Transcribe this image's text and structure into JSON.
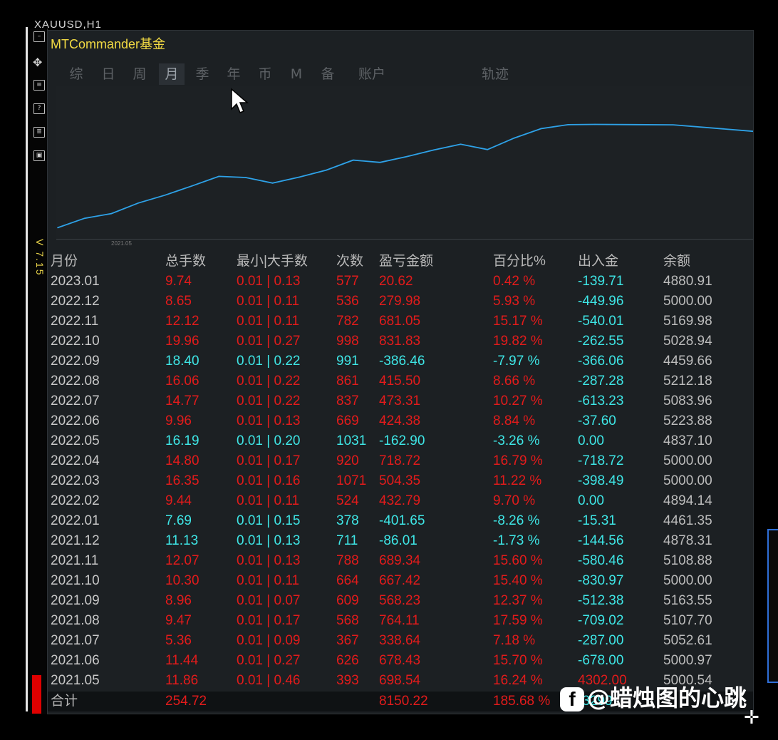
{
  "window": {
    "symbol_title": "XAUUSD,H1",
    "version": "V 7.15"
  },
  "panel": {
    "title": "MTCommander基金",
    "tabs": [
      "综",
      "日",
      "周",
      "月",
      "季",
      "年",
      "币",
      "M",
      "备",
      "账户",
      "轨迹"
    ],
    "active_tab": "月"
  },
  "toolbar_icons": [
    "minimize-icon",
    "move-icon",
    "clear-icon",
    "help-icon",
    "settings-icon",
    "restore-icon"
  ],
  "chart_data": {
    "type": "line",
    "x": [
      "2021.05",
      "2021.06",
      "2021.07",
      "2021.08",
      "2021.09",
      "2021.10",
      "2021.11",
      "2021.12",
      "2022.01",
      "2022.02",
      "2022.03",
      "2022.04",
      "2022.05",
      "2022.06",
      "2022.07",
      "2022.08",
      "2022.09",
      "2022.10",
      "2022.11",
      "2022.12",
      "2023.01"
    ],
    "series": [
      {
        "values": [
          698.54,
          1376.97,
          1715.61,
          2479.72,
          3047.95,
          3715.37,
          4404.71,
          4318.7,
          3917.05,
          4349.84,
          4854.19,
          5572.91,
          5410.01,
          5834.39,
          6307.7,
          6723.2,
          6336.74,
          7168.57,
          7849.62,
          8129.6,
          8150.22
        ],
        "color": "#2ea2e8"
      }
    ],
    "xlabel": "",
    "ylabel": "",
    "tick_labels": [
      "2021.05"
    ],
    "ylim": [
      0,
      10800
    ],
    "grid": false
  },
  "table": {
    "headers": [
      "月份",
      "总手数",
      "最小|大手数",
      "次数",
      "盈亏金额",
      "百分比%",
      "出入金",
      "余额"
    ],
    "rows": [
      {
        "month": "2023.01",
        "lots": "9.74",
        "minmax": "0.01 | 0.13",
        "count": "577",
        "pnl": "20.62",
        "pct": "0.42 %",
        "flow": "-139.71",
        "balance": "4880.91",
        "sign": "pos"
      },
      {
        "month": "2022.12",
        "lots": "8.65",
        "minmax": "0.01 | 0.11",
        "count": "536",
        "pnl": "279.98",
        "pct": "5.93 %",
        "flow": "-449.96",
        "balance": "5000.00",
        "sign": "pos"
      },
      {
        "month": "2022.11",
        "lots": "12.12",
        "minmax": "0.01 | 0.11",
        "count": "782",
        "pnl": "681.05",
        "pct": "15.17 %",
        "flow": "-540.01",
        "balance": "5169.98",
        "sign": "pos"
      },
      {
        "month": "2022.10",
        "lots": "19.96",
        "minmax": "0.01 | 0.27",
        "count": "998",
        "pnl": "831.83",
        "pct": "19.82 %",
        "flow": "-262.55",
        "balance": "5028.94",
        "sign": "pos"
      },
      {
        "month": "2022.09",
        "lots": "18.40",
        "minmax": "0.01 | 0.22",
        "count": "991",
        "pnl": "-386.46",
        "pct": "-7.97 %",
        "flow": "-366.06",
        "balance": "4459.66",
        "sign": "neg"
      },
      {
        "month": "2022.08",
        "lots": "16.06",
        "minmax": "0.01 | 0.22",
        "count": "861",
        "pnl": "415.50",
        "pct": "8.66 %",
        "flow": "-287.28",
        "balance": "5212.18",
        "sign": "pos"
      },
      {
        "month": "2022.07",
        "lots": "14.77",
        "minmax": "0.01 | 0.22",
        "count": "837",
        "pnl": "473.31",
        "pct": "10.27 %",
        "flow": "-613.23",
        "balance": "5083.96",
        "sign": "pos"
      },
      {
        "month": "2022.06",
        "lots": "9.96",
        "minmax": "0.01 | 0.13",
        "count": "669",
        "pnl": "424.38",
        "pct": "8.84 %",
        "flow": "-37.60",
        "balance": "5223.88",
        "sign": "pos"
      },
      {
        "month": "2022.05",
        "lots": "16.19",
        "minmax": "0.01 | 0.20",
        "count": "1031",
        "pnl": "-162.90",
        "pct": "-3.26 %",
        "flow": "0.00",
        "balance": "4837.10",
        "sign": "neg"
      },
      {
        "month": "2022.04",
        "lots": "14.80",
        "minmax": "0.01 | 0.17",
        "count": "920",
        "pnl": "718.72",
        "pct": "16.79 %",
        "flow": "-718.72",
        "balance": "5000.00",
        "sign": "pos"
      },
      {
        "month": "2022.03",
        "lots": "16.35",
        "minmax": "0.01 | 0.16",
        "count": "1071",
        "pnl": "504.35",
        "pct": "11.22 %",
        "flow": "-398.49",
        "balance": "5000.00",
        "sign": "pos"
      },
      {
        "month": "2022.02",
        "lots": "9.44",
        "minmax": "0.01 | 0.11",
        "count": "524",
        "pnl": "432.79",
        "pct": "9.70 %",
        "flow": "0.00",
        "balance": "4894.14",
        "sign": "pos"
      },
      {
        "month": "2022.01",
        "lots": "7.69",
        "minmax": "0.01 | 0.15",
        "count": "378",
        "pnl": "-401.65",
        "pct": "-8.26 %",
        "flow": "-15.31",
        "balance": "4461.35",
        "sign": "neg"
      },
      {
        "month": "2021.12",
        "lots": "11.13",
        "minmax": "0.01 | 0.13",
        "count": "711",
        "pnl": "-86.01",
        "pct": "-1.73 %",
        "flow": "-144.56",
        "balance": "4878.31",
        "sign": "neg"
      },
      {
        "month": "2021.11",
        "lots": "12.07",
        "minmax": "0.01 | 0.13",
        "count": "788",
        "pnl": "689.34",
        "pct": "15.60 %",
        "flow": "-580.46",
        "balance": "5108.88",
        "sign": "pos"
      },
      {
        "month": "2021.10",
        "lots": "10.30",
        "minmax": "0.01 | 0.11",
        "count": "664",
        "pnl": "667.42",
        "pct": "15.40 %",
        "flow": "-830.97",
        "balance": "5000.00",
        "sign": "pos"
      },
      {
        "month": "2021.09",
        "lots": "8.96",
        "minmax": "0.01 | 0.07",
        "count": "609",
        "pnl": "568.23",
        "pct": "12.37 %",
        "flow": "-512.38",
        "balance": "5163.55",
        "sign": "pos"
      },
      {
        "month": "2021.08",
        "lots": "9.47",
        "minmax": "0.01 | 0.17",
        "count": "568",
        "pnl": "764.11",
        "pct": "17.59 %",
        "flow": "-709.02",
        "balance": "5107.70",
        "sign": "pos"
      },
      {
        "month": "2021.07",
        "lots": "5.36",
        "minmax": "0.01 | 0.09",
        "count": "367",
        "pnl": "338.64",
        "pct": "7.18 %",
        "flow": "-287.00",
        "balance": "5052.61",
        "sign": "pos"
      },
      {
        "month": "2021.06",
        "lots": "11.44",
        "minmax": "0.01 | 0.27",
        "count": "626",
        "pnl": "678.43",
        "pct": "15.70 %",
        "flow": "-678.00",
        "balance": "5000.97",
        "sign": "pos"
      },
      {
        "month": "2021.05",
        "lots": "11.86",
        "minmax": "0.01 | 0.46",
        "count": "393",
        "pnl": "698.54",
        "pct": "16.24 %",
        "flow": "4302.00",
        "balance": "5000.54",
        "sign": "pos",
        "flow_color": "#e31b1b"
      }
    ],
    "total": {
      "label": "合计",
      "lots": "254.72",
      "pnl": "8150.22",
      "pct": "185.68 %",
      "flow": "-3299"
    }
  },
  "watermark": {
    "text": "@蜡烛图的心跳",
    "icon": "facebook-icon"
  },
  "colors": {
    "profit": "#e31b1b",
    "loss": "#3ee6e6",
    "title": "#f2da43",
    "line": "#2ea2e8"
  }
}
